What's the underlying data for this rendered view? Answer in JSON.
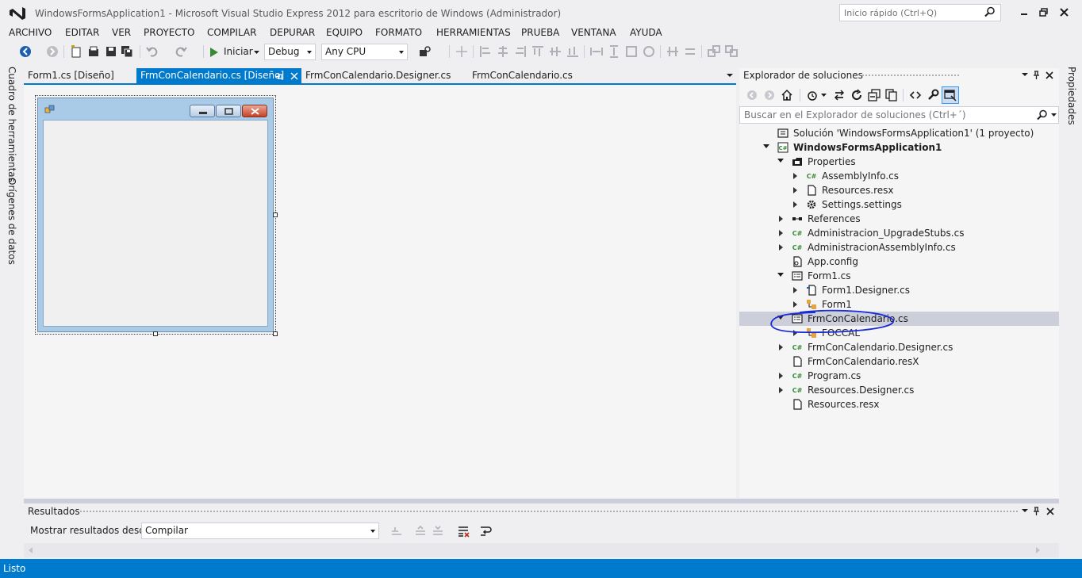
{
  "window": {
    "title": "WindowsFormsApplication1 - Microsoft Visual Studio Express 2012 para escritorio de Windows (Administrador)",
    "quick_launch_placeholder": "Inicio rápido (Ctrl+Q)"
  },
  "menu": [
    "ARCHIVO",
    "EDITAR",
    "VER",
    "PROYECTO",
    "COMPILAR",
    "DEPURAR",
    "EQUIPO",
    "FORMATO",
    "HERRAMIENTAS",
    "PRUEBA",
    "VENTANA",
    "AYUDA"
  ],
  "toolbar": {
    "start_label": "Iniciar",
    "config_value": "Debug",
    "platform_value": "Any CPU"
  },
  "left_tabs": [
    "Cuadro de herramientas",
    "Orígenes de datos"
  ],
  "right_tabs": [
    "Propiedades"
  ],
  "doc_tabs": [
    {
      "label": "Form1.cs [Diseño]",
      "active": false
    },
    {
      "label": "FrmConCalendario.cs [Diseño]",
      "active": true
    },
    {
      "label": "FrmConCalendario.Designer.cs",
      "active": false
    },
    {
      "label": "FrmConCalendario.cs",
      "active": false
    }
  ],
  "solution_explorer": {
    "title": "Explorador de soluciones",
    "search_placeholder": "Buscar en el Explorador de soluciones (Ctrl+´)",
    "tree": [
      {
        "label": "Solución 'WindowsFormsApplication1'  (1 proyecto)",
        "icon": "solution-icon",
        "expander": "none",
        "bold": false
      },
      {
        "label": "WindowsFormsApplication1",
        "icon": "csharp-project-icon",
        "expander": "open",
        "bold": true
      },
      {
        "label": "Properties",
        "icon": "properties-folder-icon",
        "expander": "open",
        "bold": false
      },
      {
        "label": "AssemblyInfo.cs",
        "icon": "csharp-file-icon",
        "expander": "closed",
        "bold": false
      },
      {
        "label": "Resources.resx",
        "icon": "resource-file-icon",
        "expander": "closed",
        "bold": false
      },
      {
        "label": "Settings.settings",
        "icon": "settings-gear-icon",
        "expander": "closed",
        "bold": false
      },
      {
        "label": "References",
        "icon": "references-icon",
        "expander": "closed",
        "bold": false
      },
      {
        "label": "Administracion_UpgradeStubs.cs",
        "icon": "csharp-file-icon",
        "expander": "closed",
        "bold": false
      },
      {
        "label": "AdministracionAssemblyInfo.cs",
        "icon": "csharp-file-icon",
        "expander": "closed",
        "bold": false
      },
      {
        "label": "App.config",
        "icon": "config-file-icon",
        "expander": "none",
        "bold": false
      },
      {
        "label": "Form1.cs",
        "icon": "form-file-icon",
        "expander": "open",
        "bold": false
      },
      {
        "label": "Form1.Designer.cs",
        "icon": "designer-file-icon",
        "expander": "closed",
        "bold": false
      },
      {
        "label": "Form1",
        "icon": "class-icon",
        "expander": "closed",
        "bold": false
      },
      {
        "label": "FrmConCalendario.cs",
        "icon": "form-file-icon",
        "expander": "open",
        "bold": false,
        "selected": true
      },
      {
        "label": "FOCCAL",
        "icon": "class-icon",
        "expander": "closed",
        "bold": false
      },
      {
        "label": "FrmConCalendario.Designer.cs",
        "icon": "csharp-file-icon",
        "expander": "closed",
        "bold": false
      },
      {
        "label": "FrmConCalendario.resX",
        "icon": "resource-file-icon",
        "expander": "none",
        "bold": false
      },
      {
        "label": "Program.cs",
        "icon": "csharp-file-icon",
        "expander": "closed",
        "bold": false
      },
      {
        "label": "Resources.Designer.cs",
        "icon": "csharp-file-icon",
        "expander": "closed",
        "bold": false
      },
      {
        "label": "Resources.resx",
        "icon": "resource-file-icon",
        "expander": "none",
        "bold": false
      }
    ]
  },
  "results": {
    "title": "Resultados",
    "show_from_label": "Mostrar resultados desde:",
    "show_from_value": "Compilar"
  },
  "status": {
    "text": "Listo"
  },
  "colors": {
    "accent": "#007acc",
    "annotation": "#1a2bd8"
  }
}
